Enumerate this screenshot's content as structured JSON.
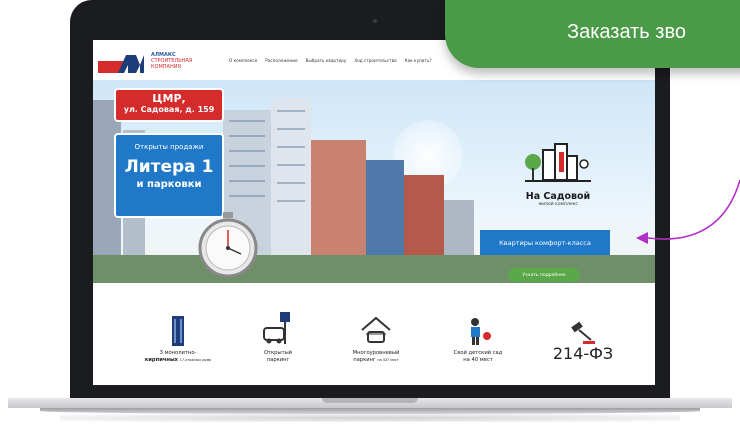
{
  "site": {
    "logo": {
      "title": "АЛМАКС",
      "line2": "СТРОИТЕЛЬНАЯ",
      "line3": "КОМПАНИЯ"
    },
    "nav": [
      "О комплексе",
      "Расположение",
      "Выбрать квартиру",
      "Ход строительства",
      "Как купить?"
    ]
  },
  "hero": {
    "address_line1": "ЦМР,",
    "address_line2": "ул. Садовая, д. 159",
    "sale_line1": "Открыты продажи",
    "sale_line2": "Литера 1",
    "sale_line3": "и парковки",
    "brand_name": "На Садовой",
    "brand_sub": "жилой комплекс",
    "cta_primary": "Квартиры комфорт-класса",
    "cta_secondary": "Узнать подробнее"
  },
  "features": [
    {
      "icon": "building-icon",
      "line1": "3 монолитно-",
      "line2": "кирпичных",
      "small": "17-этажных дома"
    },
    {
      "icon": "parking-icon",
      "line1": "Открытый",
      "line2": "паркинг",
      "small": ""
    },
    {
      "icon": "garage-icon",
      "line1": "Многоуровневый",
      "line2": "паркинг",
      "small": "на 437 мест"
    },
    {
      "icon": "kindergarten-icon",
      "line1": "Свой детский сад",
      "line2": "на 40 мест",
      "small": ""
    },
    {
      "icon": "gavel-icon",
      "law": "214-ФЗ"
    }
  ],
  "overlay": {
    "order_call": "Заказать зво"
  },
  "colors": {
    "brand_red": "#d62b2b",
    "brand_blue": "#1f78c8",
    "green": "#4a9a47",
    "arrow": "#b02fc4"
  }
}
